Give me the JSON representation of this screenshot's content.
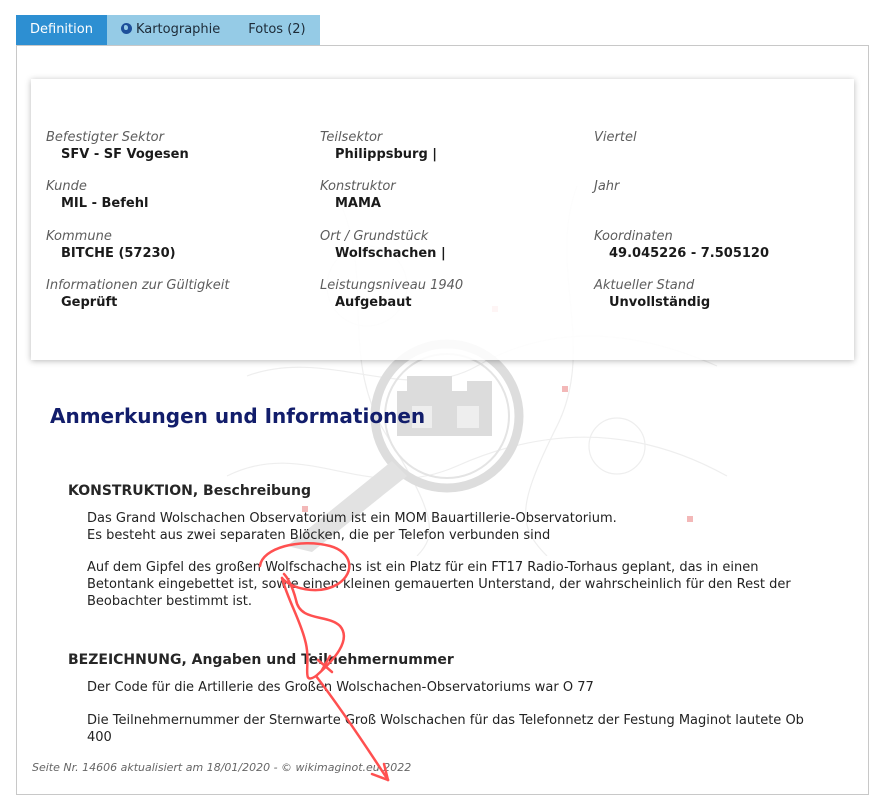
{
  "tabs": [
    {
      "label": "Definition",
      "active": true
    },
    {
      "label": "Kartographie",
      "icon": "globe-icon"
    },
    {
      "label": "Fotos (2)"
    }
  ],
  "info": {
    "befestigter_sektor": {
      "label": "Befestigter Sektor",
      "value": "SFV - SF Vogesen"
    },
    "teilsektor": {
      "label": "Teilsektor",
      "value": "Philippsburg |"
    },
    "viertel": {
      "label": "Viertel",
      "value": ""
    },
    "kunde": {
      "label": "Kunde",
      "value": "MIL - Befehl"
    },
    "konstruktor": {
      "label": "Konstruktor",
      "value": "MAMA"
    },
    "jahr": {
      "label": "Jahr",
      "value": ""
    },
    "kommune": {
      "label": "Kommune",
      "value": "BITCHE (57230)"
    },
    "ort": {
      "label": "Ort / Grundstück",
      "value": "Wolfschachen |"
    },
    "koordinaten": {
      "label": "Koordinaten",
      "value": "49.045226 - 7.505120"
    },
    "gueltigkeit": {
      "label": "Informationen zur Gültigkeit",
      "value": "Geprüft"
    },
    "leistungsniveau": {
      "label": "Leistungsniveau 1940",
      "value": "Aufgebaut"
    },
    "stand": {
      "label": "Aktueller Stand",
      "value": "Unvollständig"
    }
  },
  "notes": {
    "title": "Anmerkungen und Informationen",
    "konstruktion": {
      "heading": "KONSTRUKTION, Beschreibung",
      "p1_line1": "Das Grand Wolschachen Observatorium ist ein MOM Bauartillerie-Observatorium.",
      "p1_line2": "Es besteht aus zwei separaten Blöcken, die per Telefon verbunden sind",
      "p2": "Auf dem Gipfel des großen Wolfschachens ist ein Platz für ein FT17 Radio-Torhaus geplant, das in einen Betontank eingebettet ist, sowie einen kleinen gemauerten Unterstand, der wahrscheinlich für den Rest der Beobachter bestimmt ist."
    },
    "bezeichnung": {
      "heading": "BEZEICHNUNG, Angaben und Teilnehmernummer",
      "p1": "Der Code für die Artillerie des Großen Wolschachen-Observatoriums war O 77",
      "p2": "Die Teilnehmernummer der Sternwarte Groß Wolschachen für das Telefonnetz der Festung Maginot lautete Ob 400"
    }
  },
  "footer": "Seite Nr. 14606 aktualisiert am 18/01/2020 - © wikimaginot.eu 2022",
  "colors": {
    "tab_active": "#2d8fd2",
    "tab_inactive": "#95cbe6",
    "heading": "#121d6b",
    "annotation": "#ff5050"
  }
}
